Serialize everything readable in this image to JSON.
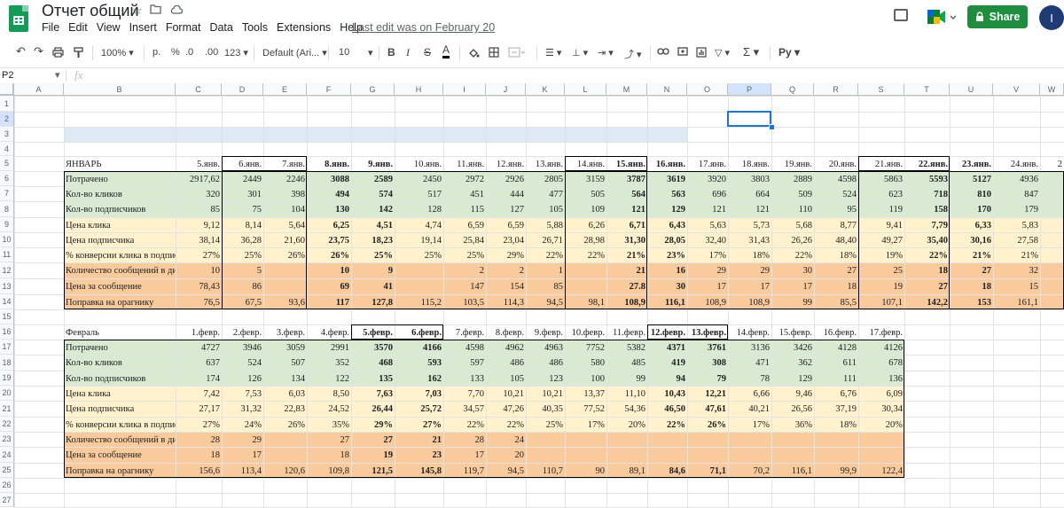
{
  "app": {
    "doc_title": "Отчет общий",
    "menu": [
      "File",
      "Edit",
      "View",
      "Insert",
      "Format",
      "Data",
      "Tools",
      "Extensions",
      "Help"
    ],
    "last_edit": "Last edit was on February 20",
    "share_label": "Share",
    "avatar_letter": "I"
  },
  "toolbar": {
    "zoom": "100%",
    "currency": "р.",
    "percent": "%",
    "dec_less": ".0",
    "dec_more": ".00",
    "more_formats": "123",
    "font": "Default (Ari...",
    "font_size": "10",
    "bold": "B",
    "italic": "I",
    "strike": "S",
    "textcolor": "A",
    "input_tools": "Pу"
  },
  "formula_bar": {
    "cell_ref": "P2",
    "fx": "fx",
    "value": ""
  },
  "columns": [
    "A",
    "B",
    "C",
    "D",
    "E",
    "F",
    "G",
    "H",
    "I",
    "J",
    "K",
    "L",
    "M",
    "N",
    "O",
    "P",
    "Q",
    "R",
    "S",
    "T",
    "U",
    "V",
    "W"
  ],
  "rows": [
    "1",
    "2",
    "3",
    "4",
    "5",
    "6",
    "7",
    "8",
    "9",
    "10",
    "11",
    "12",
    "13",
    "14",
    "15",
    "16",
    "17",
    "18",
    "19",
    "20",
    "21",
    "22",
    "23",
    "24",
    "25",
    "26",
    "27"
  ],
  "colors": {
    "green": "#d9ead3",
    "yellow": "#fff2cc",
    "orange": "#f9cb9c",
    "blue": "#dfe9f6",
    "select": "#1a73e8"
  },
  "january": {
    "title": "ЯНВАРЬ",
    "dates": [
      "5.янв.",
      "6.янв.",
      "7.янв.",
      "8.янв.",
      "9.янв.",
      "10.янв.",
      "11.янв.",
      "12.янв.",
      "13.янв.",
      "14.янв.",
      "15.янв.",
      "16.янв.",
      "17.янв.",
      "18.янв.",
      "19.янв.",
      "20.янв.",
      "21.янв.",
      "22.янв.",
      "23.янв.",
      "24.янв.",
      "2"
    ],
    "rows": [
      {
        "label": "Потрачено",
        "values": [
          "2917,62",
          "2449",
          "2246",
          "3088",
          "2589",
          "2450",
          "2972",
          "2926",
          "2805",
          "3159",
          "3787",
          "3619",
          "3920",
          "3803",
          "2889",
          "4598",
          "5863",
          "5593",
          "5127",
          "4936",
          ""
        ]
      },
      {
        "label": "Кол-во кликов",
        "values": [
          "320",
          "301",
          "398",
          "494",
          "574",
          "517",
          "451",
          "444",
          "477",
          "505",
          "564",
          "563",
          "696",
          "664",
          "509",
          "524",
          "623",
          "718",
          "810",
          "847",
          ""
        ]
      },
      {
        "label": "Кол-во подписчиков",
        "values": [
          "85",
          "75",
          "104",
          "130",
          "142",
          "128",
          "115",
          "127",
          "105",
          "109",
          "121",
          "129",
          "121",
          "121",
          "110",
          "95",
          "119",
          "158",
          "170",
          "179",
          ""
        ]
      },
      {
        "label": "Цена клика",
        "values": [
          "9,12",
          "8,14",
          "5,64",
          "6,25",
          "4,51",
          "4,74",
          "6,59",
          "6,59",
          "5,88",
          "6,26",
          "6,71",
          "6,43",
          "5,63",
          "5,73",
          "5,68",
          "8,77",
          "9,41",
          "7,79",
          "6,33",
          "5,83",
          ""
        ]
      },
      {
        "label": "Цена подписчика",
        "values": [
          "38,14",
          "36,28",
          "21,60",
          "23,75",
          "18,23",
          "19,14",
          "25,84",
          "23,04",
          "26,71",
          "28,98",
          "31,30",
          "28,05",
          "32,40",
          "31,43",
          "26,26",
          "48,40",
          "49,27",
          "35,40",
          "30,16",
          "27,58",
          ""
        ]
      },
      {
        "label": "% конверсии клика в подписку",
        "values": [
          "27%",
          "25%",
          "26%",
          "26%",
          "25%",
          "25%",
          "25%",
          "29%",
          "22%",
          "22%",
          "21%",
          "23%",
          "17%",
          "18%",
          "22%",
          "18%",
          "19%",
          "22%",
          "21%",
          "21%",
          ""
        ]
      },
      {
        "label": "Количество сообщений в директ",
        "values": [
          "10",
          "5",
          "",
          "10",
          "9",
          "",
          "2",
          "2",
          "1",
          "",
          "21",
          "16",
          "29",
          "29",
          "30",
          "27",
          "25",
          "18",
          "27",
          "32",
          ""
        ]
      },
      {
        "label": "Цена за сообщение",
        "values": [
          "78,43",
          "86",
          "",
          "69",
          "41",
          "",
          "147",
          "154",
          "85",
          "",
          "27.8",
          "30",
          "17",
          "17",
          "17",
          "18",
          "19",
          "27",
          "18",
          "15",
          ""
        ]
      },
      {
        "label": "Поправка на орагнику",
        "values": [
          "76,5",
          "67,5",
          "93,6",
          "117",
          "127,8",
          "115,2",
          "103,5",
          "114,3",
          "94,5",
          "98,1",
          "108,9",
          "116,1",
          "108,9",
          "108,9",
          "99",
          "85,5",
          "107,1",
          "142,2",
          "153",
          "161,1",
          ""
        ]
      }
    ]
  },
  "february": {
    "title": "Февраль",
    "dates": [
      "1.февр.",
      "2.февр.",
      "3.февр.",
      "4.февр.",
      "5.февр.",
      "6.февр.",
      "7.февр.",
      "8.февр.",
      "9.февр.",
      "10.февр.",
      "11.февр.",
      "12.февр.",
      "13.февр.",
      "14.февр.",
      "15.февр.",
      "16.февр.",
      "17.февр."
    ],
    "rows": [
      {
        "label": "Потрачено",
        "values": [
          "4727",
          "3946",
          "3059",
          "2991",
          "3570",
          "4166",
          "4598",
          "4962",
          "4963",
          "7752",
          "5382",
          "4371",
          "3761",
          "3136",
          "3426",
          "4128",
          "4126"
        ]
      },
      {
        "label": "Кол-во кликов",
        "values": [
          "637",
          "524",
          "507",
          "352",
          "468",
          "593",
          "597",
          "486",
          "486",
          "580",
          "485",
          "419",
          "308",
          "471",
          "362",
          "611",
          "678"
        ]
      },
      {
        "label": "Кол-во подписчиков",
        "values": [
          "174",
          "126",
          "134",
          "122",
          "135",
          "162",
          "133",
          "105",
          "123",
          "100",
          "99",
          "94",
          "79",
          "78",
          "129",
          "111",
          "136"
        ]
      },
      {
        "label": "Цена клика",
        "values": [
          "7,42",
          "7,53",
          "6,03",
          "8,50",
          "7,63",
          "7,03",
          "7,70",
          "10,21",
          "10,21",
          "13,37",
          "11,10",
          "10,43",
          "12,21",
          "6,66",
          "9,46",
          "6,76",
          "6,09"
        ]
      },
      {
        "label": "Цена подписчика",
        "values": [
          "27,17",
          "31,32",
          "22,83",
          "24,52",
          "26,44",
          "25,72",
          "34,57",
          "47,26",
          "40,35",
          "77,52",
          "54,36",
          "46,50",
          "47,61",
          "40,21",
          "26,56",
          "37,19",
          "30,34"
        ]
      },
      {
        "label": "% конверсии клика в подписку",
        "values": [
          "27%",
          "24%",
          "26%",
          "35%",
          "29%",
          "27%",
          "22%",
          "22%",
          "25%",
          "17%",
          "20%",
          "22%",
          "26%",
          "17%",
          "36%",
          "18%",
          "20%"
        ]
      },
      {
        "label": "Количество сообщений в директ",
        "values": [
          "28",
          "29",
          "",
          "27",
          "27",
          "21",
          "28",
          "24",
          "",
          "",
          "",
          "",
          "",
          "",
          "",
          "",
          ""
        ]
      },
      {
        "label": "Цена за сообщение",
        "values": [
          "18",
          "17",
          "",
          "18",
          "19",
          "23",
          "17",
          "20",
          "",
          "",
          "",
          "",
          "",
          "",
          "",
          "",
          ""
        ]
      },
      {
        "label": "Поправка на орагнику",
        "values": [
          "156,6",
          "113,4",
          "120,6",
          "109,8",
          "121,5",
          "145,8",
          "119,7",
          "94,5",
          "110,7",
          "90",
          "89,1",
          "84,6",
          "71,1",
          "70,2",
          "116,1",
          "99,9",
          "122,4"
        ]
      }
    ]
  }
}
